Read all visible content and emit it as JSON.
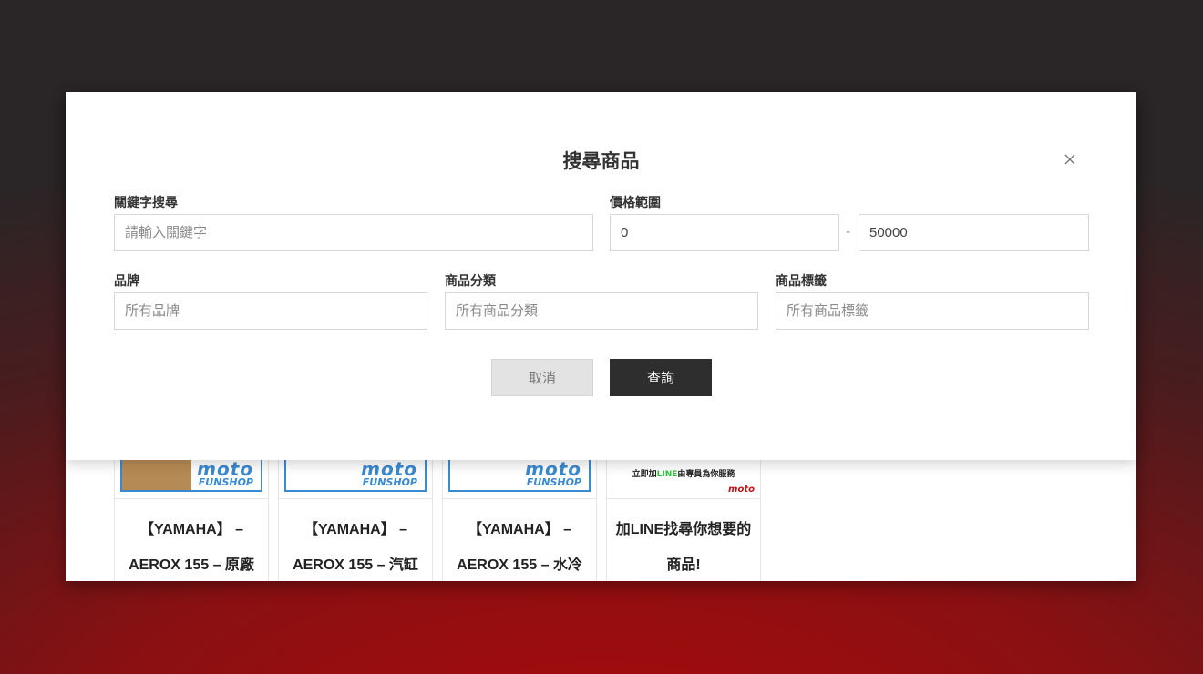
{
  "modal": {
    "title": "搜尋商品",
    "keyword": {
      "label": "關鍵字搜尋",
      "placeholder": "請輸入關鍵字",
      "value": ""
    },
    "price": {
      "label": "價格範圍",
      "min": "0",
      "max": "50000",
      "separator": "-"
    },
    "brand": {
      "label": "品牌",
      "placeholder": "所有品牌"
    },
    "category": {
      "label": "商品分類",
      "placeholder": "所有商品分類"
    },
    "tag": {
      "label": "商品標籤",
      "placeholder": "所有商品標籤"
    },
    "cancel_label": "取消",
    "search_label": "查詢"
  },
  "products": [
    {
      "title": "【YAMAHA】 – AEROX 155 – 原廠"
    },
    {
      "title": "【YAMAHA】 – AEROX 155 – 汽缸"
    },
    {
      "title": "【YAMAHA】 – AEROX 155 – 水冷"
    },
    {
      "title": "加LINE找尋你想要的商品!"
    }
  ],
  "logo": {
    "moto": "moto",
    "fun": "FUNSHOP"
  },
  "line_banner": {
    "prefix": "立即加",
    "line": "LINE",
    "suffix": "由專員為你服務",
    "mini_logo": "moto"
  },
  "colors": {
    "accent_blue": "#3a8ad0",
    "line_green": "#2fbf3a",
    "dark_button": "#2e2e2e"
  }
}
